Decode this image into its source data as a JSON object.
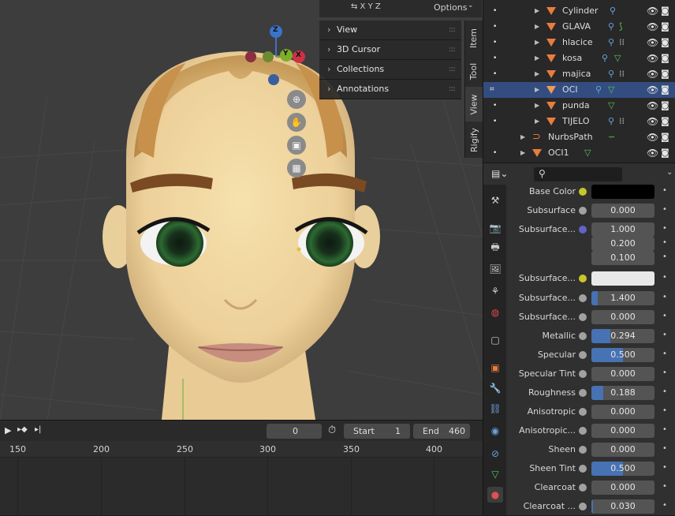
{
  "viewport": {
    "header_options_label": "Options",
    "gizmo_axes": {
      "z": "Z",
      "y": "Y",
      "x": "X"
    },
    "npanel_sections": [
      "View",
      "3D Cursor",
      "Collections",
      "Annotations"
    ],
    "sidebar_tabs": [
      "Item",
      "Tool",
      "View",
      "Rigify"
    ]
  },
  "timeline": {
    "current_frame": "0",
    "start_label": "Start",
    "start_value": "1",
    "end_label": "End",
    "end_value": "460",
    "ruler_frames": [
      "150",
      "200",
      "250",
      "300",
      "350",
      "400"
    ]
  },
  "outliner": {
    "items": [
      {
        "name": "Cylinder",
        "level": 2,
        "type": "mesh",
        "selected": false
      },
      {
        "name": "GLAVA",
        "level": 2,
        "type": "mesh",
        "selected": false
      },
      {
        "name": "hlacice",
        "level": 2,
        "type": "mesh",
        "selected": false
      },
      {
        "name": "kosa",
        "level": 2,
        "type": "mesh",
        "selected": false
      },
      {
        "name": "majica",
        "level": 2,
        "type": "mesh",
        "selected": false
      },
      {
        "name": "OCI",
        "level": 2,
        "type": "mesh",
        "selected": true
      },
      {
        "name": "punda",
        "level": 2,
        "type": "mesh",
        "selected": false
      },
      {
        "name": "TIJELO",
        "level": 2,
        "type": "mesh",
        "selected": false
      },
      {
        "name": "NurbsPath",
        "level": 1,
        "type": "curve",
        "selected": false
      },
      {
        "name": "OCI1",
        "level": 1,
        "type": "mesh",
        "selected": false
      }
    ]
  },
  "properties": {
    "search_placeholder": "",
    "rows": [
      {
        "label": "Base Color",
        "socket": "yellow",
        "kind": "color",
        "color": "#000000"
      },
      {
        "label": "Subsurface",
        "socket": "gray",
        "kind": "value",
        "value": "0.000",
        "fill": 0
      },
      {
        "label": "Subsurface...",
        "socket": "purple",
        "kind": "vector",
        "values": [
          "1.000",
          "0.200",
          "0.100"
        ]
      },
      {
        "label": "Subsurface...",
        "socket": "yellow",
        "kind": "color",
        "color": "#e8e8e8"
      },
      {
        "label": "Subsurface...",
        "socket": "gray",
        "kind": "value",
        "value": "1.400",
        "fill": 0.1
      },
      {
        "label": "Subsurface...",
        "socket": "gray",
        "kind": "value",
        "value": "0.000",
        "fill": 0
      },
      {
        "label": "Metallic",
        "socket": "gray",
        "kind": "value",
        "value": "0.294",
        "fill": 0.294
      },
      {
        "label": "Specular",
        "socket": "gray",
        "kind": "value",
        "value": "0.500",
        "fill": 0.5
      },
      {
        "label": "Specular Tint",
        "socket": "gray",
        "kind": "value",
        "value": "0.000",
        "fill": 0
      },
      {
        "label": "Roughness",
        "socket": "gray",
        "kind": "value",
        "value": "0.188",
        "fill": 0.188
      },
      {
        "label": "Anisotropic",
        "socket": "gray",
        "kind": "value",
        "value": "0.000",
        "fill": 0
      },
      {
        "label": "Anisotropic...",
        "socket": "gray",
        "kind": "value",
        "value": "0.000",
        "fill": 0
      },
      {
        "label": "Sheen",
        "socket": "gray",
        "kind": "value",
        "value": "0.000",
        "fill": 0
      },
      {
        "label": "Sheen Tint",
        "socket": "gray",
        "kind": "value",
        "value": "0.500",
        "fill": 0.5
      },
      {
        "label": "Clearcoat",
        "socket": "gray",
        "kind": "value",
        "value": "0.000",
        "fill": 0
      },
      {
        "label": "Clearcoat ...",
        "socket": "ring",
        "kind": "value",
        "value": "0.030",
        "fill": 0.03
      }
    ]
  },
  "colors": {
    "accent_blue": "#4772b3",
    "selection": "#334d80",
    "object_orange": "#e87d3e",
    "mesh_green": "#5ec45a",
    "modifier_blue": "#6aa4e0"
  }
}
